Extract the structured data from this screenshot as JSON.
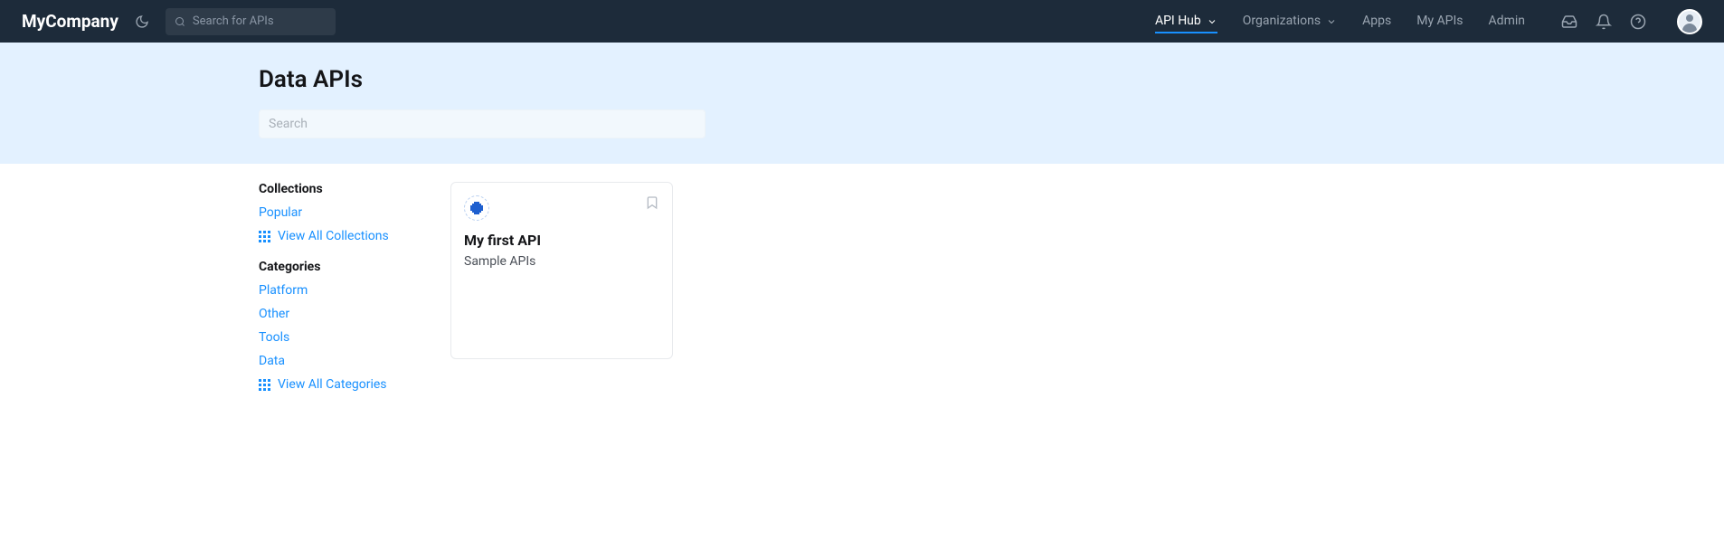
{
  "header": {
    "logo": "MyCompany",
    "search_placeholder": "Search for APIs",
    "nav": {
      "api_hub": "API Hub",
      "organizations": "Organizations",
      "apps": "Apps",
      "my_apis": "My APIs",
      "admin": "Admin"
    }
  },
  "page": {
    "title": "Data APIs",
    "search_placeholder": "Search"
  },
  "sidebar": {
    "collections_heading": "Collections",
    "collections": {
      "popular": "Popular",
      "view_all": "View All Collections"
    },
    "categories_heading": "Categories",
    "categories": {
      "platform": "Platform",
      "other": "Other",
      "tools": "Tools",
      "data": "Data",
      "view_all": "View All Categories"
    }
  },
  "cards": [
    {
      "title": "My first API",
      "desc": "Sample APIs"
    }
  ]
}
